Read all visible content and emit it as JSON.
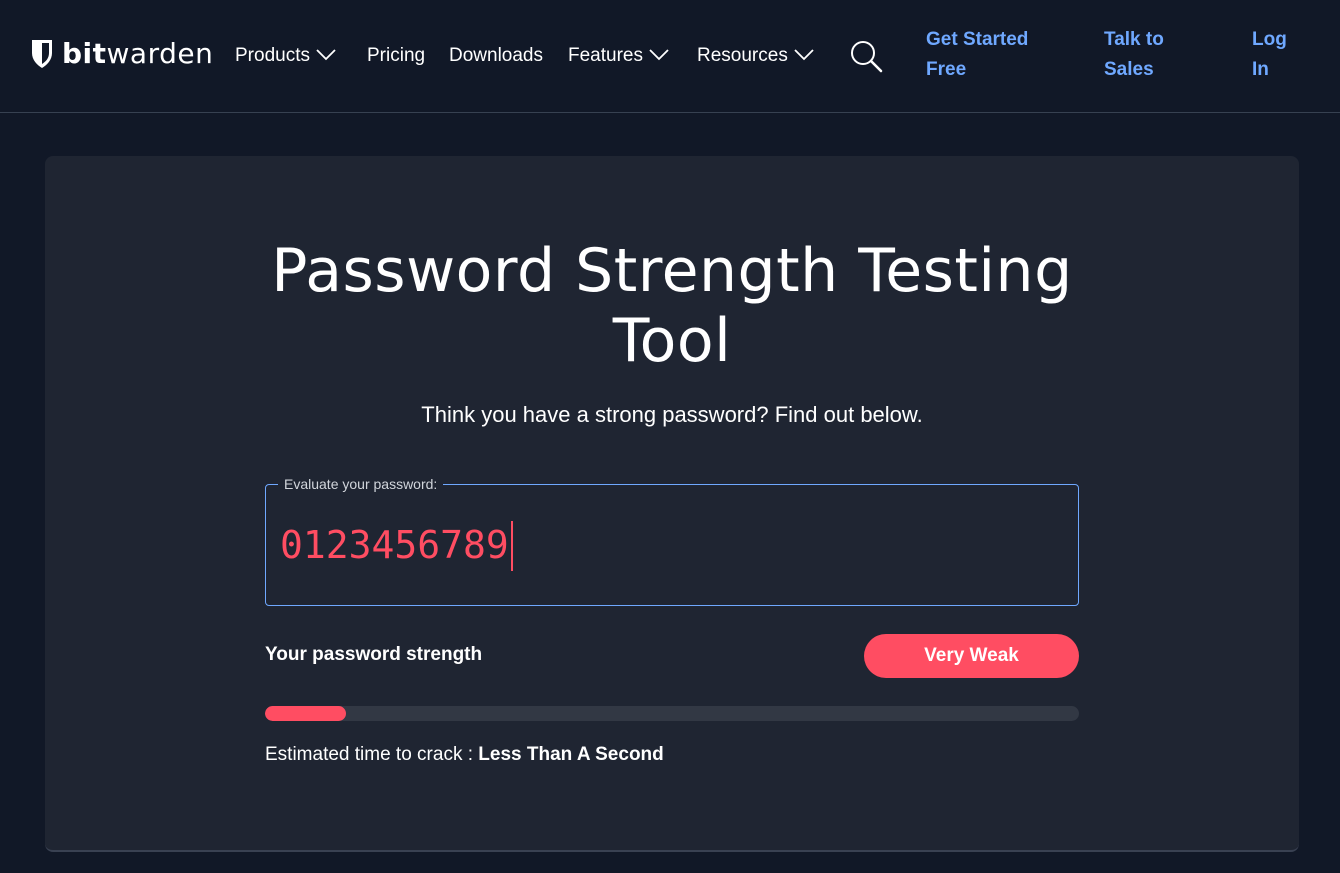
{
  "header": {
    "logo": {
      "bold": "bit",
      "regular": "warden",
      "icon": "shield-icon"
    },
    "nav": [
      {
        "label": "Products",
        "has_dropdown": true
      },
      {
        "label": "Pricing",
        "has_dropdown": false
      },
      {
        "label": "Downloads",
        "has_dropdown": false
      },
      {
        "label": "Features",
        "has_dropdown": true
      },
      {
        "label": "Resources",
        "has_dropdown": true
      }
    ],
    "search_icon": "search-icon",
    "cta": [
      {
        "line1": "Get Started",
        "line2": "Free"
      },
      {
        "line1": "Talk to",
        "line2": "Sales"
      },
      {
        "line1": "Log",
        "line2": "In"
      }
    ]
  },
  "main": {
    "title_line1": "Password Strength Testing",
    "title_line2": "Tool",
    "subtitle": "Think you have a strong password? Find out below.",
    "field_label": "Evaluate your password:",
    "password_value": "0123456789",
    "strength_label": "Your password strength",
    "strength_rating": "Very Weak",
    "strength_fraction": 0.1,
    "crack_label": "Estimated time to crack : ",
    "crack_value": "Less Than A Second"
  },
  "colors": {
    "background": "#111827",
    "card": "#1f2532",
    "accent_link": "#6fa8ff",
    "weak": "#ff4d62",
    "meter_track": "#323844"
  }
}
